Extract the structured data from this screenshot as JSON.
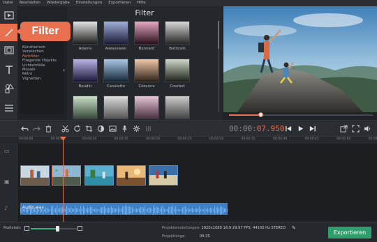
{
  "menu": [
    "Datei",
    "Bearbeiten",
    "Wiedergabe",
    "Einstellungen",
    "Exportieren",
    "Hilfe"
  ],
  "bubble": {
    "label": "Filter"
  },
  "filters": {
    "title": "Filter",
    "categories": [
      "Künstlerisch",
      "Verwischen",
      "Farbfilter",
      "Fliegende Objekte",
      "Lichteinfälle",
      "Mosaik",
      "Retro",
      "Vignetten"
    ],
    "selected_category": "Farbfilter",
    "items": [
      {
        "name": "Adams",
        "top": "#e2e2e2",
        "bottom": "#1e1e1e"
      },
      {
        "name": "Aiwasowski",
        "top": "#9fb0d8",
        "bottom": "#1e1b3a"
      },
      {
        "name": "Bonnard",
        "top": "#e7a9c3",
        "bottom": "#2a0f1c"
      },
      {
        "name": "Botticelli",
        "top": "#d8d8d8",
        "bottom": "#262626"
      },
      {
        "name": "Boudin",
        "top": "#b8b4e8",
        "bottom": "#1a1836"
      },
      {
        "name": "Canaletto",
        "top": "#a8c8e6",
        "bottom": "#162536"
      },
      {
        "name": "Cézanne",
        "top": "#f0c9a8",
        "bottom": "#2e2018"
      },
      {
        "name": "Courbet",
        "top": "#cfd8c8",
        "bottom": "#1c221a"
      },
      {
        "name": "",
        "top": "#c9e0c8",
        "bottom": "#3a4a3a"
      },
      {
        "name": "",
        "top": "#dcdcdc",
        "bottom": "#555555"
      },
      {
        "name": "",
        "top": "#e6c7d8",
        "bottom": "#4a3040"
      },
      {
        "name": "",
        "top": "#cccccc",
        "bottom": "#444444"
      }
    ]
  },
  "timecode": {
    "dim": "00:00:",
    "highlight": "07.950"
  },
  "ruler": [
    "00:00:00",
    "00:00:05",
    "00:00:10",
    "00:00:15",
    "00:00:20",
    "00:00:25",
    "00:00:30",
    "00:00:35",
    "00:00:40",
    "00:00:45",
    "00:00:50",
    "00:00:55"
  ],
  "audio": {
    "label": "Audio.wav"
  },
  "zoom": {
    "label": "Maßstab:",
    "level": 0.58
  },
  "project": {
    "settings_label": "Projekteinstellungen:",
    "settings_value": "1920x1080 16:9 29.97 FPS, 44100 Hz STEREO",
    "length_label": "Projektlänge:",
    "length_value": "00:35"
  },
  "export": {
    "label": "Exportieren"
  },
  "colors": {
    "accent": "#e8704f",
    "export": "#2f9e6c",
    "audio": "#3c7fc2"
  }
}
